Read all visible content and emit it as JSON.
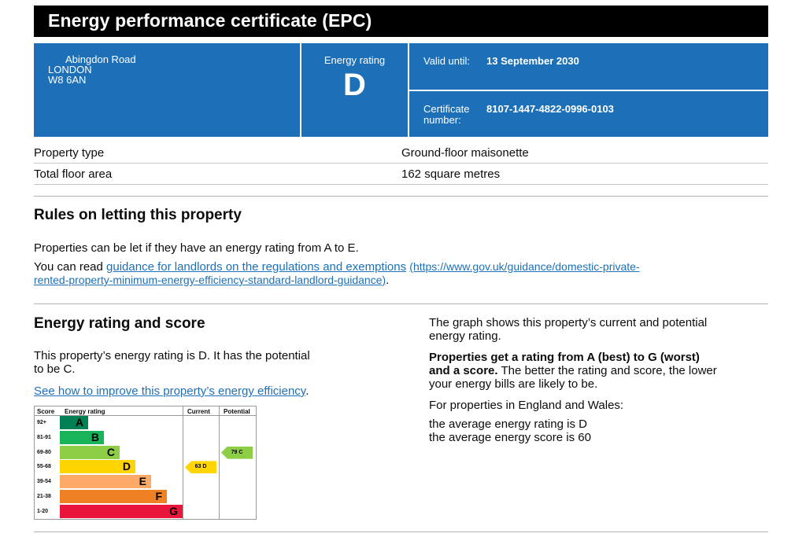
{
  "header": {
    "title": "Energy performance certificate (EPC)"
  },
  "summary": {
    "address_line1": "Abingdon Road",
    "address_line2": "LONDON",
    "address_line3": "W8 6AN",
    "rating_label": "Energy rating",
    "rating_letter": "D",
    "valid_label": "Valid until:",
    "valid_value": "13 September 2030",
    "cert_label": "Certificate number:",
    "cert_value": "8107-1447-4822-0996-0103"
  },
  "property": [
    {
      "label": "Property type",
      "value": "Ground-floor maisonette"
    },
    {
      "label": "Total floor area",
      "value": "162 square metres"
    }
  ],
  "letting": {
    "heading": "Rules on letting this property",
    "para1": "Properties can be let if they have an energy rating from A to E.",
    "para2_prefix": "You can read ",
    "link_text": "guidance for landlords on the regulations and exemptions",
    "link_url_line1": "(https://www.gov.uk/guidance/domestic-private-",
    "link_url_line2": "rented-property-minimum-energy-efficiency-standard-landlord-guidance)",
    "para2_suffix": "."
  },
  "rating_section": {
    "heading": "Energy rating and score",
    "para_line1": "This property’s energy rating is D. It has the potential",
    "para_line2": "to be C.",
    "improve_link": "See how to improve this property’s energy efficiency",
    "improve_suffix": ".",
    "right_p1_line1": "The graph shows this property’s current and potential",
    "right_p1_line2": "energy rating.",
    "right_p2_bold_line1": "Properties get a rating from A (best) to G (worst)",
    "right_p2_bold_line2": "and a score.",
    "right_p2_rest_line2": " The better the rating and score, the lower",
    "right_p2_line3": "your energy bills are likely to be.",
    "right_p3": "For properties in England and Wales:",
    "right_p4_line1": "the average energy rating is D",
    "right_p4_line2": "the average energy score is 60"
  },
  "chart_data": {
    "type": "bar",
    "headers": {
      "score": "Score",
      "rating": "Energy rating",
      "current": "Current",
      "potential": "Potential"
    },
    "bands": [
      {
        "score": "92+",
        "letter": "A",
        "color": "#008054"
      },
      {
        "score": "81-91",
        "letter": "B",
        "color": "#19b459"
      },
      {
        "score": "69-80",
        "letter": "C",
        "color": "#8dce46"
      },
      {
        "score": "55-68",
        "letter": "D",
        "color": "#ffd500"
      },
      {
        "score": "39-54",
        "letter": "E",
        "color": "#fcaa65"
      },
      {
        "score": "21-38",
        "letter": "F",
        "color": "#ef8023"
      },
      {
        "score": "1-20",
        "letter": "G",
        "color": "#e9153b"
      }
    ],
    "current": {
      "score": 63,
      "letter": "D",
      "label": "63 D",
      "color": "#ffd500"
    },
    "potential": {
      "score": 79,
      "letter": "C",
      "label": "79 C",
      "color": "#8dce46"
    }
  }
}
